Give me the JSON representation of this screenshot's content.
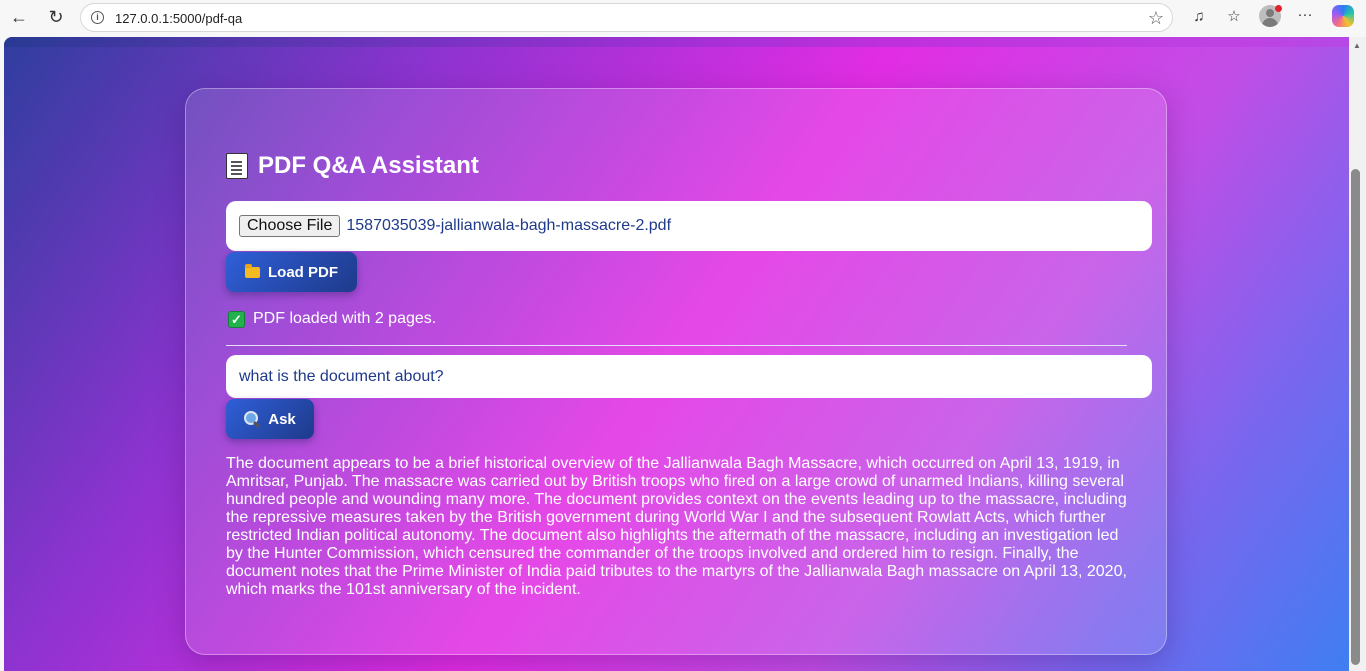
{
  "browser": {
    "url": "127.0.0.1:5000/pdf-qa"
  },
  "app": {
    "title": "PDF Q&A Assistant"
  },
  "file_input": {
    "button_label": "Choose File",
    "file_name": "1587035039-jallianwala-bagh-massacre-2.pdf"
  },
  "load_button": {
    "label": "Load PDF"
  },
  "status": {
    "text": "PDF loaded with 2 pages."
  },
  "question": {
    "value": "what is the document about?"
  },
  "ask_button": {
    "label": "Ask"
  },
  "answer": {
    "text": "The document appears to be a brief historical overview of the Jallianwala Bagh Massacre, which occurred on April 13, 1919, in Amritsar, Punjab. The massacre was carried out by British troops who fired on a large crowd of unarmed Indians, killing several hundred people and wounding many more. The document provides context on the events leading up to the massacre, including the repressive measures taken by the British government during World War I and the subsequent Rowlatt Acts, which further restricted Indian political autonomy. The document also highlights the aftermath of the massacre, including an investigation led by the Hunter Commission, which censured the commander of the troops involved and ordered him to resign. Finally, the document notes that the Prime Minister of India paid tributes to the martyrs of the Jallianwala Bagh massacre on April 13, 2020, which marks the 101st anniversary of the incident."
  },
  "colors": {
    "button_gradient_start": "#2f5fd8",
    "button_gradient_end": "#1e3a8a",
    "input_text": "#1f3a8a",
    "background_left": "#2f3e9e",
    "background_center": "#e22de4",
    "background_right": "#3f7ef2"
  },
  "icons": {
    "title": "document-icon",
    "load": "folder-icon",
    "status": "check-icon",
    "ask": "search-icon"
  }
}
